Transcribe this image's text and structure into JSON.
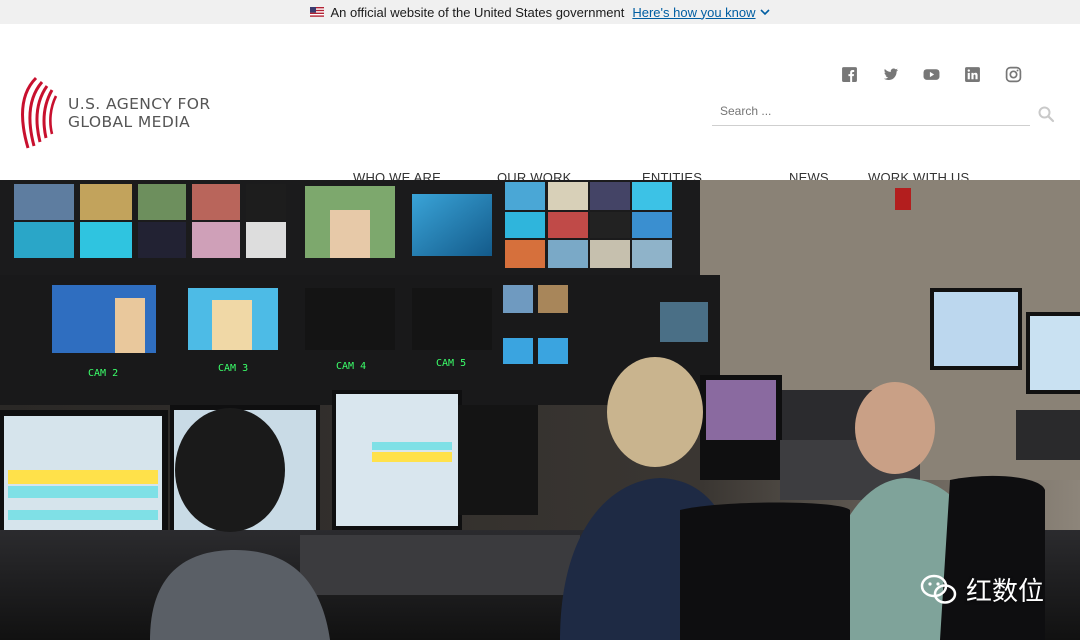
{
  "gov_banner": {
    "text": "An official website of the United States government",
    "link": "Here's how you know"
  },
  "header": {
    "logo_line1": "U.S. AGENCY FOR",
    "logo_line2": "GLOBAL MEDIA",
    "search_placeholder": "Search ...",
    "social": [
      "facebook-icon",
      "twitter-icon",
      "youtube-icon",
      "linkedin-icon",
      "instagram-icon"
    ]
  },
  "nav": {
    "items": [
      "WHO WE ARE",
      "OUR WORK",
      "ENTITIES",
      "NEWS",
      "WORK WITH US"
    ]
  },
  "hero": {
    "monitor_labels": [
      "CAM 2",
      "CAM 3",
      "CAM 4",
      "CAM 5"
    ],
    "watermark": "红数位"
  },
  "colors": {
    "brand_red": "#c8102e",
    "link_blue": "#005ea2",
    "banner_bg": "#f0f0f0",
    "monitor_green": "#3bff6a"
  }
}
